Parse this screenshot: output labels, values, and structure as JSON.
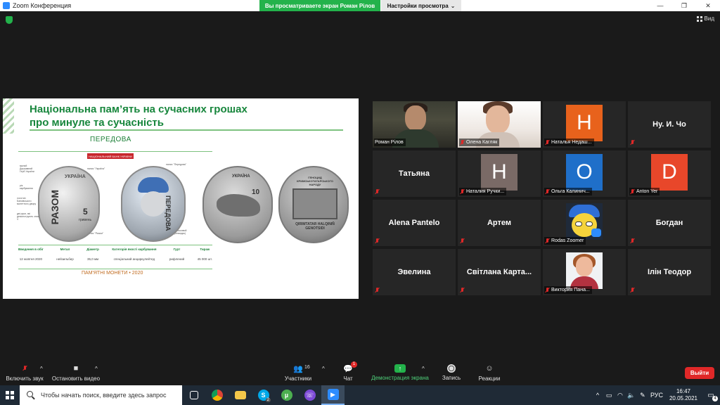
{
  "window": {
    "title": "Zoom Конференция",
    "share_banner": "Вы просматриваете экран Роман Рілов",
    "view_settings": "Настройки просмотра",
    "view_button": "Вид"
  },
  "slide": {
    "heading_line1": "Національна пам’ять на сучасних грошах",
    "heading_line2": "про минуле та сучасність",
    "coin_title": "ПЕРЕДОВА",
    "badge": "НАЦІОНАЛЬНИЙ БАНК УКРАЇНИ",
    "coin1": {
      "label": "УКРАЇНА",
      "word": "РАЗОМ",
      "number": "5",
      "unit": "гривень"
    },
    "coin2": {
      "word": "ПЕРЕДОВА"
    },
    "coin3": {
      "label": "УКРАЇНА",
      "number": "10"
    },
    "coin4": {
      "top": "ГЕНОЦИД КРИМСЬКОТАТАРСЬКОГО НАРОДУ",
      "bottom": "QIRIMTATAR HALQINIÑ GENOTSIDI"
    },
    "annotations": [
      "малий Державний Герб України",
      "рік карбування",
      "логотип Банківського монетного двору",
      "дві руки, які демонструють знак V",
      "напис \"Україна\"",
      "напис \"Разом\"",
      "напис \"Передова\"",
      "військовий (немедик)"
    ],
    "specs": [
      {
        "key": "Введення в обіг",
        "value": "12 жовтня 2020"
      },
      {
        "key": "Метал",
        "value": "нейзильбер"
      },
      {
        "key": "Діаметр",
        "value": "35,0 мм"
      },
      {
        "key": "Категорія якості карбування",
        "value": "спеціальний анциркулейтед"
      },
      {
        "key": "Гурт",
        "value": "рифлений"
      },
      {
        "key": "Тираж",
        "value": "45 000 шт."
      }
    ],
    "footer": "ПАМ'ЯТНІ МОНЕТИ • 2020"
  },
  "participants": [
    {
      "name": "Роман Рілов",
      "type": "photo1",
      "muted": false,
      "active": true
    },
    {
      "name": "Олена Кагляк",
      "type": "photo2",
      "muted": true
    },
    {
      "name": "Наталья Недаш...",
      "type": "avatar",
      "letter": "H",
      "color": "#e8621c",
      "muted": true
    },
    {
      "name": "Ну. И. Чо",
      "type": "name",
      "muted": true
    },
    {
      "name": "Татьяна",
      "type": "name",
      "muted": true
    },
    {
      "name": "Наталия Ручки...",
      "type": "avatar",
      "letter": "H",
      "color": "#7a6a66",
      "muted": true
    },
    {
      "name": "Ольга Калинич...",
      "type": "avatar",
      "letter": "O",
      "color": "#1f6fc9",
      "muted": true
    },
    {
      "name": "Anton Yer",
      "type": "avatar",
      "letter": "D",
      "color": "#e8472a",
      "muted": true
    },
    {
      "name": "Alena Pantelo",
      "type": "name",
      "muted": true
    },
    {
      "name": "Артем",
      "type": "name",
      "muted": true
    },
    {
      "name": "Rodas Zoomer",
      "type": "zoomer",
      "muted": true
    },
    {
      "name": "Богдан",
      "type": "name",
      "muted": true
    },
    {
      "name": "Эвелина",
      "type": "name",
      "muted": true
    },
    {
      "name": "Світлана Карта...",
      "type": "name",
      "muted": true
    },
    {
      "name": "Виктория Пана...",
      "type": "photo-vp",
      "muted": true
    },
    {
      "name": "Ілін Теодор",
      "type": "name",
      "muted": true
    }
  ],
  "toolbar": {
    "mute": "Включить звук",
    "video": "Остановить видео",
    "participants": "Участники",
    "participants_count": "16",
    "chat": "Чат",
    "chat_badge": "1",
    "share": "Демонстрация экрана",
    "record": "Запись",
    "reactions": "Реакции",
    "leave": "Выйти"
  },
  "taskbar": {
    "search_placeholder": "Чтобы начать поиск, введите здесь запрос",
    "skype_badge": "2",
    "viber_badge": "",
    "language": "РУС",
    "time": "16:47",
    "date": "20.05.2021",
    "notifications": "4"
  },
  "colors": {
    "share_green": "#23b24b",
    "leave_red": "#e02828",
    "slide_green": "#17863c"
  }
}
